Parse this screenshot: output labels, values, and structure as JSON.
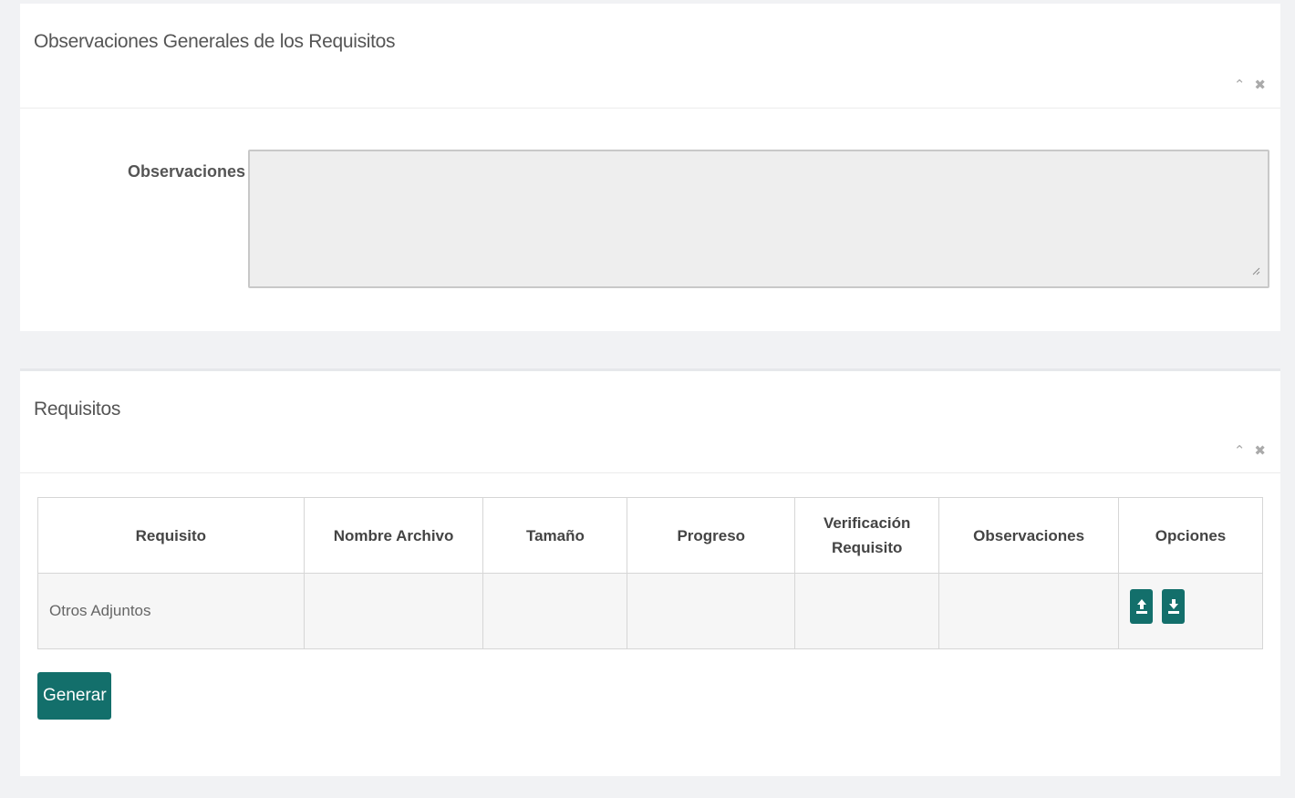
{
  "observaciones_panel": {
    "title": "Observaciones Generales de los Requisitos",
    "label": "Observaciones",
    "value": ""
  },
  "requisitos_panel": {
    "title": "Requisitos",
    "columns": [
      "Requisito",
      "Nombre Archivo",
      "Tamaño",
      "Progreso",
      "Verificación Requisito",
      "Observaciones",
      "Opciones"
    ],
    "rows": [
      {
        "requisito": "Otros Adjuntos",
        "nombre_archivo": "",
        "tamano": "",
        "progreso": "",
        "verificacion": "",
        "observaciones": ""
      }
    ],
    "generate_label": "Generar"
  },
  "icons": {
    "collapse": "chevron-up-icon",
    "close": "close-icon",
    "upload": "upload-icon",
    "download": "download-icon"
  },
  "colors": {
    "accent": "#136f6b",
    "page_bg": "#f1f2f4"
  }
}
